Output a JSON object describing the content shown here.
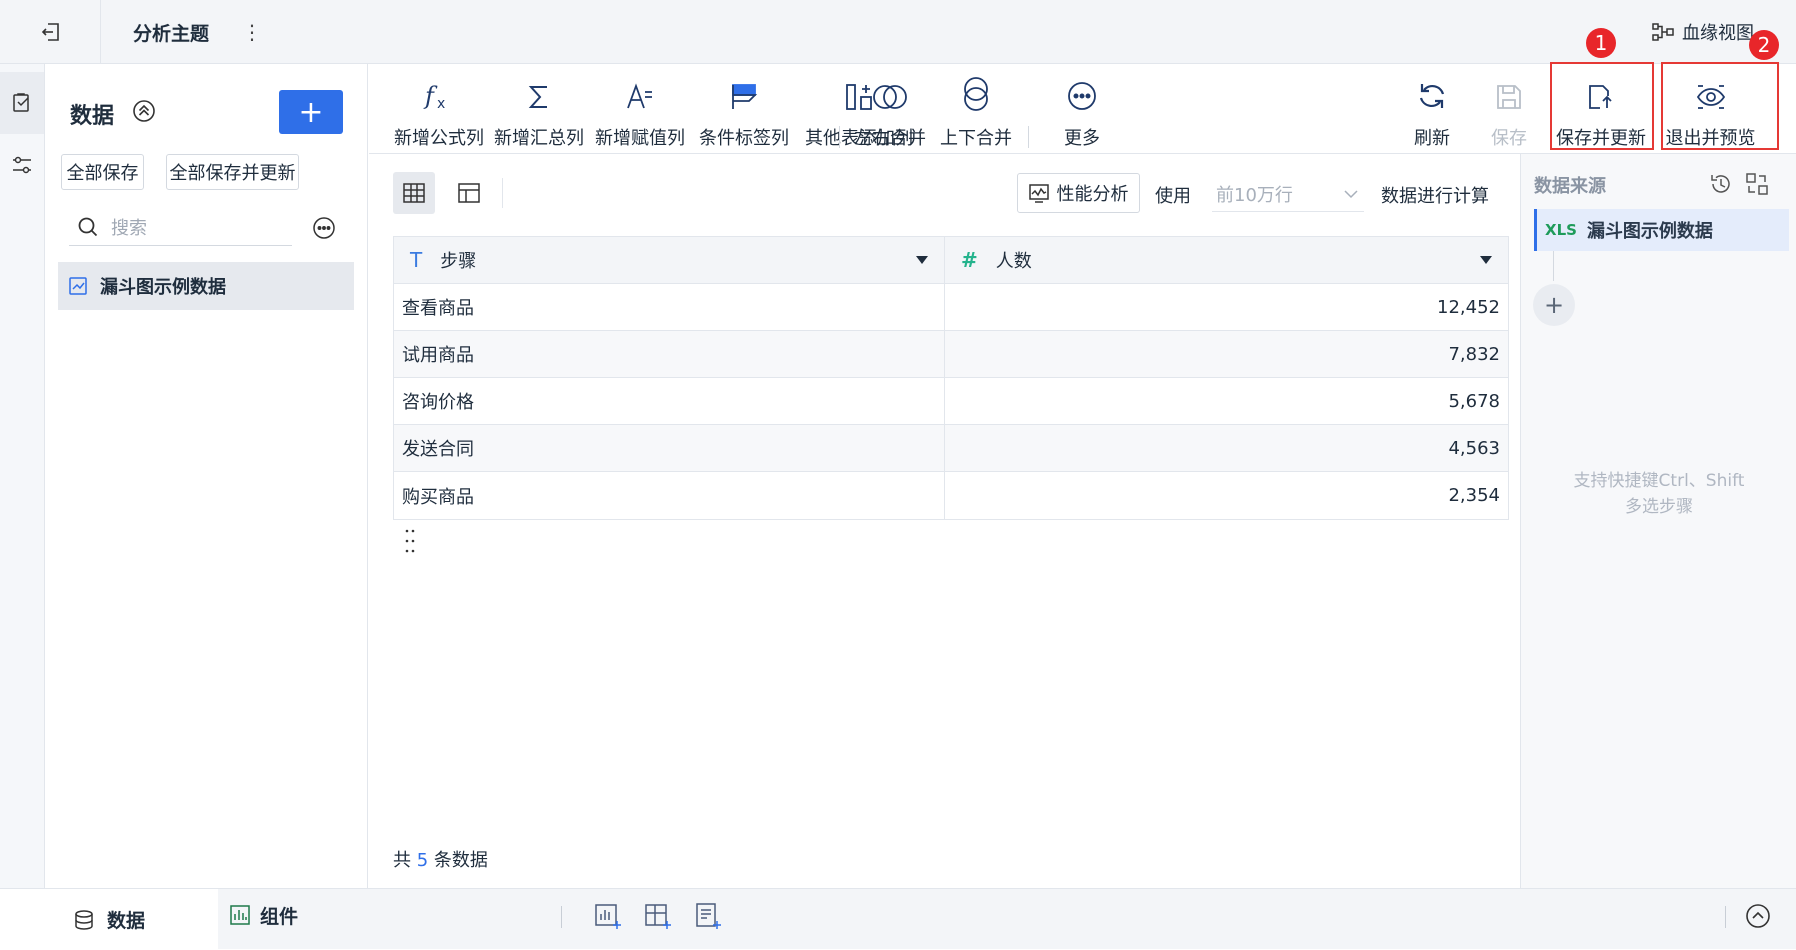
{
  "topbar": {
    "title": "分析主题",
    "more": "⋮",
    "lineage_label": "血缘视图"
  },
  "data_panel": {
    "title": "数据",
    "add_label": "+",
    "save_all": "全部保存",
    "save_all_update": "全部保存并更新",
    "search_placeholder": "搜索",
    "items": [
      {
        "label": "漏斗图示例数据"
      }
    ]
  },
  "toolbar": {
    "formula": "新增公式列",
    "summary": "新增汇总列",
    "assign": "新增赋值列",
    "condition": "条件标签列",
    "other_table": "其他表添加列",
    "lr_merge": "左右合并",
    "ud_merge": "上下合并",
    "more": "更多",
    "refresh": "刷新",
    "save": "保存",
    "save_update": "保存并更新",
    "exit_preview": "退出并预览",
    "badge1": "1",
    "badge2": "2"
  },
  "main": {
    "perf_label": "性能分析",
    "use_label": "使用",
    "rows_value": "前10万行",
    "calc_label": "数据进行计算",
    "columns": [
      {
        "name": "步骤",
        "type_glyph": "T"
      },
      {
        "name": "人数",
        "type_glyph": "#"
      }
    ],
    "rows": [
      [
        "查看商品",
        "12,452"
      ],
      [
        "试用商品",
        "7,832"
      ],
      [
        "咨询价格",
        "5,678"
      ],
      [
        "发送合同",
        "4,563"
      ],
      [
        "购买商品",
        "2,354"
      ]
    ],
    "total_prefix": "共",
    "total_count": "5",
    "total_suffix": "条数据"
  },
  "right_panel": {
    "title": "数据来源",
    "step_badge": "XLS",
    "step_label": "漏斗图示例数据",
    "add_label": "+",
    "hint_line1": "支持快捷键Ctrl、Shift",
    "hint_line2": "多选步骤"
  },
  "bottombar": {
    "tab_data": "数据",
    "tab_component": "组件"
  },
  "colors": {
    "primary": "#2f6fe8",
    "highlight_red": "#e53935",
    "number_type": "#24b38d"
  }
}
